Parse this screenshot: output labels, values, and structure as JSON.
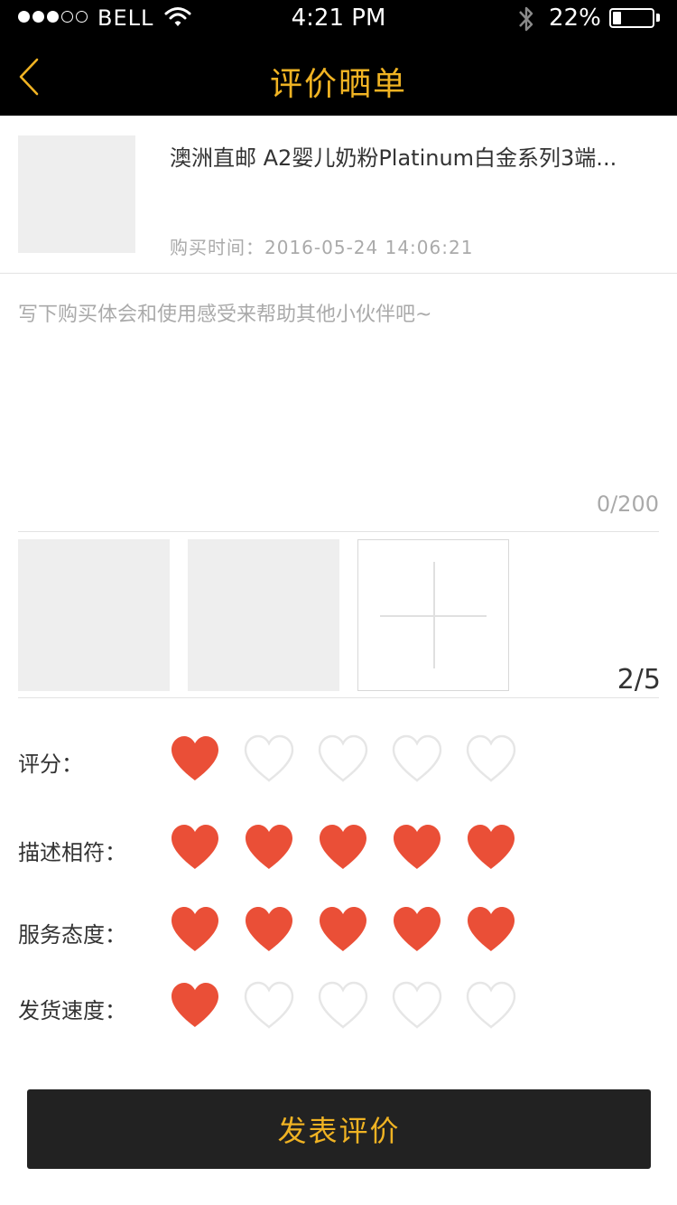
{
  "status_bar": {
    "carrier": "BELL",
    "signal_bars": 5,
    "signal_filled": 3,
    "time": "4:21 PM",
    "battery_percent_label": "22%",
    "battery_level": 0.22
  },
  "nav": {
    "title": "评价晒单",
    "back_icon": "chevron-left-icon",
    "accent_color": "#f0b323"
  },
  "product": {
    "name": "澳洲直邮 A2婴儿奶粉Platinum白金系列3端...",
    "purchase_label": "购买时间：",
    "purchase_time": "2016-05-24 14:06:21"
  },
  "review": {
    "placeholder": "写下购买体会和使用感受来帮助其他小伙伴吧~",
    "value": "",
    "char_count": "0/200"
  },
  "photos": {
    "count_label": "2/5",
    "uploaded": 2,
    "max": 5
  },
  "ratings": [
    {
      "label": "评分：",
      "value": 1,
      "max": 5
    },
    {
      "label": "描述相符：",
      "value": 5,
      "max": 5
    },
    {
      "label": "服务态度：",
      "value": 5,
      "max": 5
    },
    {
      "label": "发货速度：",
      "value": 1,
      "max": 5
    }
  ],
  "submit": {
    "label": "发表评价"
  },
  "colors": {
    "heart_filled": "#ea4f37",
    "heart_empty": "#e6e6e6",
    "button_bg": "#222222"
  }
}
